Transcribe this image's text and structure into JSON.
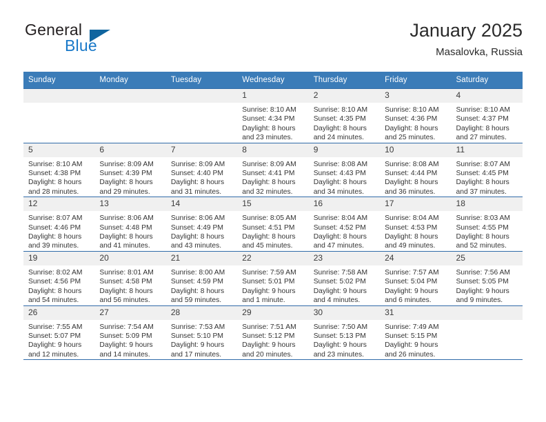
{
  "brand": {
    "name_part1": "General",
    "name_part2": "Blue",
    "logo_icon": "triangle-icon"
  },
  "header": {
    "title": "January 2025",
    "location": "Masalovka, Russia"
  },
  "calendar": {
    "weekday_headers": [
      "Sunday",
      "Monday",
      "Tuesday",
      "Wednesday",
      "Thursday",
      "Friday",
      "Saturday"
    ],
    "accent_color": "#3b7cb8",
    "grid_line_color": "#2f6aa8",
    "daynum_background": "#f0f0f0",
    "weeks": [
      [
        {
          "day": "",
          "lines": []
        },
        {
          "day": "",
          "lines": []
        },
        {
          "day": "",
          "lines": []
        },
        {
          "day": "1",
          "lines": [
            "Sunrise: 8:10 AM",
            "Sunset: 4:34 PM",
            "Daylight: 8 hours",
            "and 23 minutes."
          ]
        },
        {
          "day": "2",
          "lines": [
            "Sunrise: 8:10 AM",
            "Sunset: 4:35 PM",
            "Daylight: 8 hours",
            "and 24 minutes."
          ]
        },
        {
          "day": "3",
          "lines": [
            "Sunrise: 8:10 AM",
            "Sunset: 4:36 PM",
            "Daylight: 8 hours",
            "and 25 minutes."
          ]
        },
        {
          "day": "4",
          "lines": [
            "Sunrise: 8:10 AM",
            "Sunset: 4:37 PM",
            "Daylight: 8 hours",
            "and 27 minutes."
          ]
        }
      ],
      [
        {
          "day": "5",
          "lines": [
            "Sunrise: 8:10 AM",
            "Sunset: 4:38 PM",
            "Daylight: 8 hours",
            "and 28 minutes."
          ]
        },
        {
          "day": "6",
          "lines": [
            "Sunrise: 8:09 AM",
            "Sunset: 4:39 PM",
            "Daylight: 8 hours",
            "and 29 minutes."
          ]
        },
        {
          "day": "7",
          "lines": [
            "Sunrise: 8:09 AM",
            "Sunset: 4:40 PM",
            "Daylight: 8 hours",
            "and 31 minutes."
          ]
        },
        {
          "day": "8",
          "lines": [
            "Sunrise: 8:09 AM",
            "Sunset: 4:41 PM",
            "Daylight: 8 hours",
            "and 32 minutes."
          ]
        },
        {
          "day": "9",
          "lines": [
            "Sunrise: 8:08 AM",
            "Sunset: 4:43 PM",
            "Daylight: 8 hours",
            "and 34 minutes."
          ]
        },
        {
          "day": "10",
          "lines": [
            "Sunrise: 8:08 AM",
            "Sunset: 4:44 PM",
            "Daylight: 8 hours",
            "and 36 minutes."
          ]
        },
        {
          "day": "11",
          "lines": [
            "Sunrise: 8:07 AM",
            "Sunset: 4:45 PM",
            "Daylight: 8 hours",
            "and 37 minutes."
          ]
        }
      ],
      [
        {
          "day": "12",
          "lines": [
            "Sunrise: 8:07 AM",
            "Sunset: 4:46 PM",
            "Daylight: 8 hours",
            "and 39 minutes."
          ]
        },
        {
          "day": "13",
          "lines": [
            "Sunrise: 8:06 AM",
            "Sunset: 4:48 PM",
            "Daylight: 8 hours",
            "and 41 minutes."
          ]
        },
        {
          "day": "14",
          "lines": [
            "Sunrise: 8:06 AM",
            "Sunset: 4:49 PM",
            "Daylight: 8 hours",
            "and 43 minutes."
          ]
        },
        {
          "day": "15",
          "lines": [
            "Sunrise: 8:05 AM",
            "Sunset: 4:51 PM",
            "Daylight: 8 hours",
            "and 45 minutes."
          ]
        },
        {
          "day": "16",
          "lines": [
            "Sunrise: 8:04 AM",
            "Sunset: 4:52 PM",
            "Daylight: 8 hours",
            "and 47 minutes."
          ]
        },
        {
          "day": "17",
          "lines": [
            "Sunrise: 8:04 AM",
            "Sunset: 4:53 PM",
            "Daylight: 8 hours",
            "and 49 minutes."
          ]
        },
        {
          "day": "18",
          "lines": [
            "Sunrise: 8:03 AM",
            "Sunset: 4:55 PM",
            "Daylight: 8 hours",
            "and 52 minutes."
          ]
        }
      ],
      [
        {
          "day": "19",
          "lines": [
            "Sunrise: 8:02 AM",
            "Sunset: 4:56 PM",
            "Daylight: 8 hours",
            "and 54 minutes."
          ]
        },
        {
          "day": "20",
          "lines": [
            "Sunrise: 8:01 AM",
            "Sunset: 4:58 PM",
            "Daylight: 8 hours",
            "and 56 minutes."
          ]
        },
        {
          "day": "21",
          "lines": [
            "Sunrise: 8:00 AM",
            "Sunset: 4:59 PM",
            "Daylight: 8 hours",
            "and 59 minutes."
          ]
        },
        {
          "day": "22",
          "lines": [
            "Sunrise: 7:59 AM",
            "Sunset: 5:01 PM",
            "Daylight: 9 hours",
            "and 1 minute."
          ]
        },
        {
          "day": "23",
          "lines": [
            "Sunrise: 7:58 AM",
            "Sunset: 5:02 PM",
            "Daylight: 9 hours",
            "and 4 minutes."
          ]
        },
        {
          "day": "24",
          "lines": [
            "Sunrise: 7:57 AM",
            "Sunset: 5:04 PM",
            "Daylight: 9 hours",
            "and 6 minutes."
          ]
        },
        {
          "day": "25",
          "lines": [
            "Sunrise: 7:56 AM",
            "Sunset: 5:05 PM",
            "Daylight: 9 hours",
            "and 9 minutes."
          ]
        }
      ],
      [
        {
          "day": "26",
          "lines": [
            "Sunrise: 7:55 AM",
            "Sunset: 5:07 PM",
            "Daylight: 9 hours",
            "and 12 minutes."
          ]
        },
        {
          "day": "27",
          "lines": [
            "Sunrise: 7:54 AM",
            "Sunset: 5:09 PM",
            "Daylight: 9 hours",
            "and 14 minutes."
          ]
        },
        {
          "day": "28",
          "lines": [
            "Sunrise: 7:53 AM",
            "Sunset: 5:10 PM",
            "Daylight: 9 hours",
            "and 17 minutes."
          ]
        },
        {
          "day": "29",
          "lines": [
            "Sunrise: 7:51 AM",
            "Sunset: 5:12 PM",
            "Daylight: 9 hours",
            "and 20 minutes."
          ]
        },
        {
          "day": "30",
          "lines": [
            "Sunrise: 7:50 AM",
            "Sunset: 5:13 PM",
            "Daylight: 9 hours",
            "and 23 minutes."
          ]
        },
        {
          "day": "31",
          "lines": [
            "Sunrise: 7:49 AM",
            "Sunset: 5:15 PM",
            "Daylight: 9 hours",
            "and 26 minutes."
          ]
        },
        {
          "day": "",
          "lines": []
        }
      ]
    ]
  }
}
